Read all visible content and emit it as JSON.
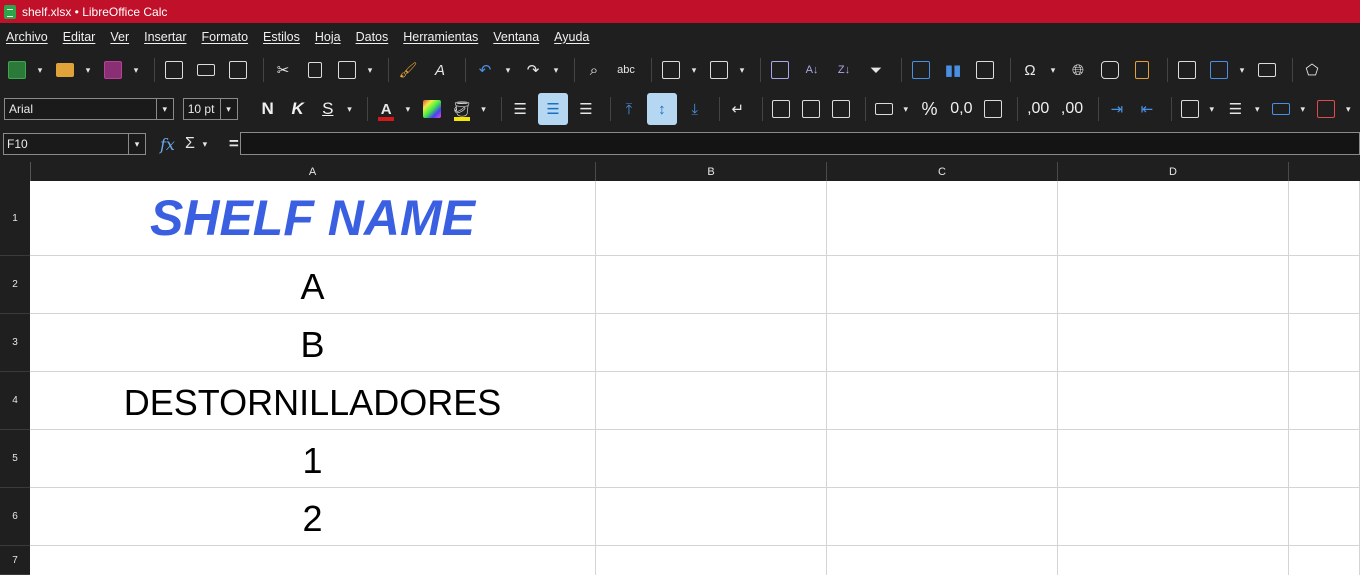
{
  "window": {
    "title": "shelf.xlsx • LibreOffice Calc"
  },
  "menu": [
    "Archivo",
    "Editar",
    "Ver",
    "Insertar",
    "Formato",
    "Estilos",
    "Hoja",
    "Datos",
    "Herramientas",
    "Ventana",
    "Ayuda"
  ],
  "toolbar2": {
    "font_name": "Arial",
    "font_size": "10 pt",
    "bold": "N",
    "italic": "K",
    "shadow": "S",
    "font_color": "#d31919",
    "highlight_color": "#f5e60a",
    "percent": "%",
    "decimal": "0,0",
    "add_decimal": ",00",
    "del_decimal": ",00"
  },
  "formula_bar": {
    "cell_ref": "F10",
    "fx": "fx",
    "sigma": "Σ",
    "equals": "=",
    "content": ""
  },
  "sheet": {
    "columns": [
      "A",
      "B",
      "C",
      "D"
    ],
    "rows": [
      "1",
      "2",
      "3",
      "4",
      "5",
      "6",
      "7"
    ],
    "cells": {
      "A1": "SHELF NAME",
      "A2": "A",
      "A3": "B",
      "A4": "DESTORNILLADORES",
      "A5": "1",
      "A6": "2"
    },
    "title_color": "#3a5fe0"
  }
}
